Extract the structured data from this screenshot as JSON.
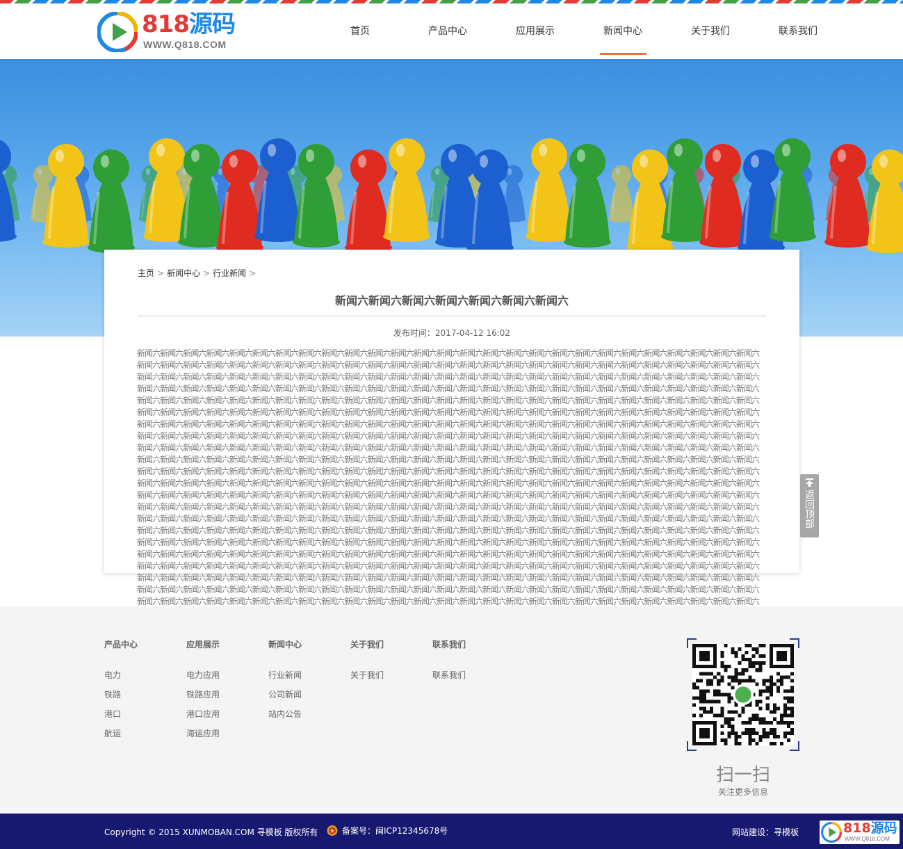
{
  "site": {
    "logo_number": "818",
    "logo_cn": "源码",
    "logo_url": "WWW.Q818.COM"
  },
  "nav": [
    {
      "label": "首页"
    },
    {
      "label": "产品中心"
    },
    {
      "label": "应用展示"
    },
    {
      "label": "新闻中心"
    },
    {
      "label": "关于我们"
    },
    {
      "label": "联系我们"
    }
  ],
  "nav_active_index": 3,
  "breadcrumb": {
    "items": [
      "主页",
      "新闻中心",
      "行业新闻"
    ],
    "separator": ">"
  },
  "article": {
    "title": "新闻六新闻六新闻六新闻六新闻六新闻六新闻六",
    "publish_label": "发布时间：2017-04-12 16:02",
    "body": "新闻六新闻六新闻六新闻六新闻六新闻六新闻六新闻六新闻六新闻六新闻六新闻六新闻六新闻六新闻六新闻六新闻六新闻六新闻六新闻六新闻六新闻六新闻六新闻六新闻六新闻六新闻六新闻六新闻六新闻六新闻六新闻六新闻六新闻六新闻六新闻六新闻六新闻六新闻六新闻六新闻六新闻六新闻六新闻六新闻六新闻六新闻六新闻六新闻六新闻六新闻六新闻六新闻六新闻六新闻六新闻六新闻六新闻六新闻六新闻六新闻六新闻六新闻六新闻六新闻六新闻六新闻六新闻六新闻六新闻六新闻六新闻六新闻六新闻六新闻六新闻六新闻六新闻六新闻六新闻六新闻六新闻六新闻六新闻六新闻六新闻六新闻六新闻六新闻六新闻六新闻六新闻六新闻六新闻六新闻六新闻六新闻六新闻六新闻六新闻六新闻六新闻六新闻六新闻六新闻六新闻六新闻六新闻六新闻六新闻六新闻六新闻六新闻六新闻六新闻六新闻六新闻六新闻六新闻六新闻六新闻六新闻六新闻六新闻六新闻六新闻六新闻六新闻六新闻六新闻六新闻六新闻六新闻六新闻六新闻六新闻六新闻六新闻六新闻六新闻六新闻六新闻六新闻六新闻六新闻六新闻六新闻六新闻六新闻六新闻六新闻六新闻六新闻六新闻六新闻六新闻六新闻六新闻六新闻六新闻六新闻六新闻六新闻六新闻六新闻六新闻六新闻六新闻六新闻六新闻六新闻六新闻六新闻六新闻六新闻六新闻六新闻六新闻六新闻六新闻六新闻六新闻六新闻六新闻六新闻六新闻六新闻六新闻六新闻六新闻六新闻六新闻六新闻六新闻六新闻六新闻六新闻六新闻六新闻六新闻六新闻六新闻六新闻六新闻六新闻六新闻六新闻六新闻六新闻六新闻六新闻六新闻六新闻六新闻六新闻六新闻六新闻六新闻六新闻六新闻六新闻六新闻六新闻六新闻六新闻六新闻六新闻六新闻六新闻六新闻六新闻六新闻六新闻六新闻六新闻六新闻六新闻六新闻六新闻六新闻六新闻六新闻六新闻六新闻六新闻六新闻六新闻六新闻六新闻六新闻六新闻六新闻六新闻六新闻六新闻六新闻六新闻六新闻六新闻六新闻六新闻六新闻六新闻六新闻六新闻六新闻六新闻六新闻六新闻六新闻六新闻六新闻六新闻六新闻六新闻六新闻六新闻六新闻六新闻六新闻六新闻六新闻六新闻六新闻六新闻六新闻六新闻六新闻六新闻六新闻六新闻六新闻六新闻六新闻六新闻六新闻六新闻六新闻六新闻六新闻六新闻六新闻六新闻六新闻六新闻六新闻六新闻六新闻六新闻六新闻六新闻六新闻六新闻六新闻六新闻六新闻六新闻六新闻六新闻六新闻六新闻六新闻六新闻六新闻六新闻六新闻六新闻六新闻六新闻六新闻六新闻六新闻六新闻六新闻六新闻六新闻六新闻六新闻六新闻六新闻六新闻六新闻六新闻六新闻六新闻六新闻六新闻六新闻六新闻六新闻六新闻六新闻六新闻六新闻六新闻六新闻六新闻六新闻六新闻六新闻六新闻六新闻六新闻六新闻六新闻六新闻六新闻六新闻六新闻六新闻六新闻六新闻六新闻六新闻六新闻六新闻六新闻六新闻六新闻六新闻六新闻六新闻六新闻六新闻六新闻六新闻六新闻六新闻六新闻六新闻六新闻六新闻六新闻六新闻六新闻六新闻六新闻六新闻六新闻六新闻六新闻六新闻六新闻六新闻六新闻六新闻六新闻六新闻六新闻六新闻六新闻六新闻六新闻六新闻六新闻六新闻六新闻六新闻六新闻六新闻六新闻六新闻六新闻六新闻六新闻六新闻六新闻六新闻六新闻六新闻六新闻六新闻六新闻六新闻六新闻六新闻六新闻六新闻六新闻六新闻六新闻六新闻六新闻六新闻六新闻六新闻六新闻六新闻六新闻六新闻六新闻六新闻六新闻六新闻六新闻六新闻六新闻六新闻六新闻六新闻六新闻六新闻六新闻六新闻六新闻六新闻六新闻六新闻六新闻六新闻六新闻六新闻六新闻六新闻六新闻六新闻六新闻六新闻六新闻六新闻六新闻六新闻六新闻六新闻六新闻六新闻六新闻六新闻六新闻六新闻六新闻六新闻六新闻六新闻六新闻六新闻六新闻六新闻六新闻六新闻六新闻六新闻六新闻六新闻六新闻六新闻六新闻六新闻六新闻六新闻六新闻六新闻六新闻六新闻六新闻六新闻六新闻六新闻六新闻六新闻六新闻六新闻六新闻六新闻六新闻六新闻六新闻六新闻六新闻六新闻六新闻六新闻六新闻六新闻六新闻六新闻六新闻六新闻六新闻六新闻六新闻六新闻六新闻六新闻六新闻六新闻六新闻六新闻六新闻六新闻六新闻六新闻六新闻六新闻六新闻六新闻六新闻六新闻六新闻六新闻六新闻六新闻六新闻六新闻六新闻六新闻六新闻六新闻六新闻六新闻六新闻六新闻六新闻六新闻六新闻六新闻六新闻六新闻六新闻六新闻六新闻六新闻六新闻六新闻六新闻六新闻六新闻六新闻六新闻六新闻六新闻六新闻六新闻六新闻六新闻六新闻六新闻六新闻六新闻六新闻六新闻六新闻六新闻六新闻六新闻六新闻六新闻六新闻六新闻六新闻六新闻六新闻六新闻六新闻六新闻六新闻六新闻六新闻六新闻六新闻六新闻六新闻六新闻六新闻六新闻六新闻六新闻六新闻六新闻六新闻六新闻六新闻六新闻六新闻六新闻六新闻六新闻六新闻六新闻六新闻六新闻六新闻六新闻六新闻六新闻六新闻六新闻六新闻六新闻六新闻六新闻六新闻六新闻六新闻六新闻六新闻六新闻六新闻六新闻六新闻六新闻六新闻六新闻六新闻六新闻六新闻六新闻六新闻六新闻六新闻六新闻六新闻六新闻六新闻六新闻六新闻六新闻六新闻六新闻六新闻六新闻六新闻六新闻六新闻六新闻六新闻六新闻六新闻六新闻六新闻六新闻六新闻六新闻六新闻六新闻六新闻六新闻六新闻六新闻六新闻六新闻六新闻六新闻六新闻六新闻六新闻六新闻六新闻六新闻六新闻六新闻六新闻六"
  },
  "back_to_top": "返回顶部",
  "footer": {
    "columns": [
      {
        "title": "产品中心",
        "links": [
          "电力",
          "铁路",
          "港口",
          "航运"
        ]
      },
      {
        "title": "应用展示",
        "links": [
          "电力应用",
          "铁路应用",
          "港口应用",
          "海运应用"
        ]
      },
      {
        "title": "新闻中心",
        "links": [
          "行业新闻",
          "公司新闻",
          "站内公告"
        ]
      },
      {
        "title": "关于我们",
        "links": [
          "关于我们"
        ]
      },
      {
        "title": "联系我们",
        "links": [
          "联系我们"
        ]
      }
    ],
    "qr_title": "扫一扫",
    "qr_subtitle": "关注更多信息"
  },
  "bottom": {
    "copyright": "Copyright © 2015 XUNMOBAN.COM 寻模板  版权所有",
    "beian": "备案号：闽ICP12345678号",
    "builder": "网站建设：寻模板",
    "mini_logo_url": "WWW.Q818.COM"
  },
  "colors": {
    "accent": "#e8713c",
    "bottom_bar": "#171970",
    "logo_red": "#e53935",
    "logo_blue": "#1e88e5"
  }
}
